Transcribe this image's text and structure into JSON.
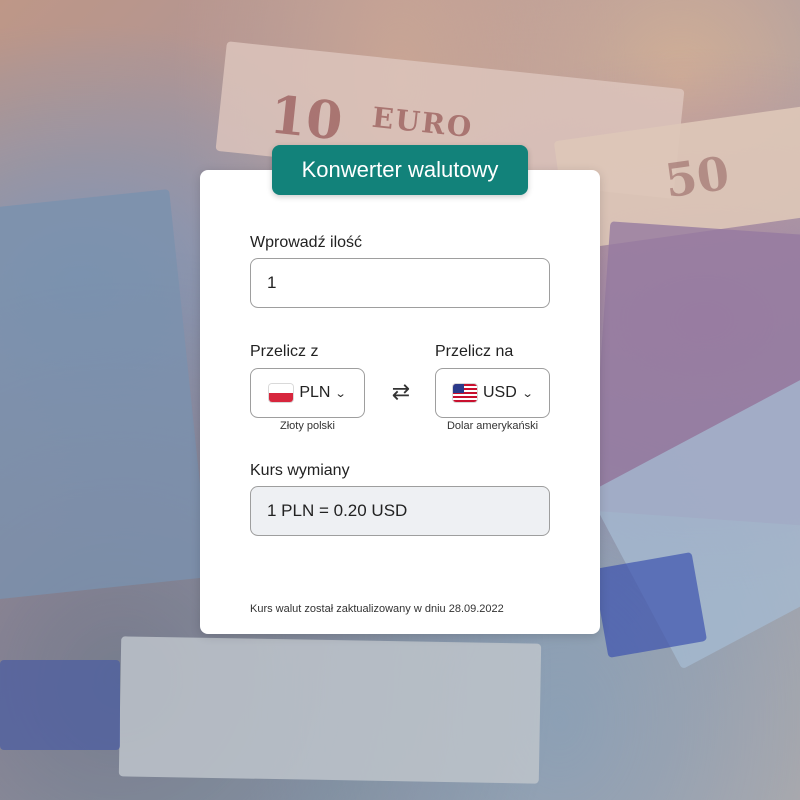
{
  "background": {
    "note_10_number": "10",
    "note_10_text": "EURO",
    "note_50_number": "50"
  },
  "app": {
    "title": "Konwerter walutowy"
  },
  "amount": {
    "label": "Wprowadź ilość",
    "value": "1"
  },
  "from": {
    "label": "Przelicz z",
    "code": "PLN",
    "name": "Złoty polski",
    "flag": "poland-flag-icon"
  },
  "to": {
    "label": "Przelicz na",
    "code": "USD",
    "name": "Dolar amerykański",
    "flag": "usa-flag-icon"
  },
  "swap": {
    "icon": "swap-arrows-icon",
    "glyph": "⇄"
  },
  "rate": {
    "label": "Kurs wymiany",
    "value": "1 PLN = 0.20 USD"
  },
  "footer": {
    "note": "Kurs walut został zaktualizowany w dniu 28.09.2022"
  },
  "colors": {
    "accent": "#12827a",
    "card": "#ffffff",
    "rate_bg": "#eef0f3"
  }
}
